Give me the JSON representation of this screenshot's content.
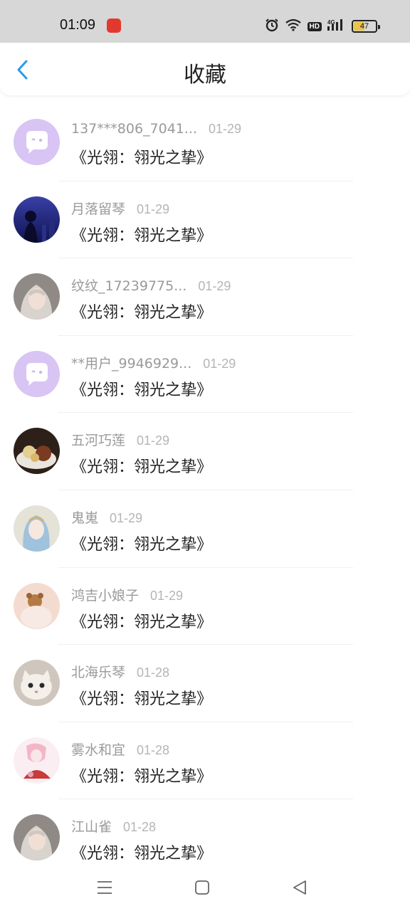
{
  "status_bar": {
    "time": "01:09",
    "battery": "47",
    "battery_level": 0.47,
    "hd_label": "HD",
    "net_label": "4G",
    "icons": [
      "app-notification-icon",
      "alarm-icon",
      "wifi-icon",
      "hd-icon",
      "4g-signal-icon",
      "battery-icon"
    ]
  },
  "header": {
    "title": "收藏",
    "back_icon": "chevron-left-icon",
    "accent_color": "#2a9ae8"
  },
  "items": [
    {
      "username": "137***806_7041...",
      "date": "01-29",
      "title": "《光翎：翎光之挚》",
      "avatar": "default-chat-avatar"
    },
    {
      "username": "月落留琴",
      "date": "01-29",
      "title": "《光翎：翎光之挚》",
      "avatar": "night-city-avatar"
    },
    {
      "username": "纹纹_17239775...",
      "date": "01-29",
      "title": "《光翎：翎光之挚》",
      "avatar": "portrait-avatar"
    },
    {
      "username": "**用户_9946929...",
      "date": "01-29",
      "title": "《光翎：翎光之挚》",
      "avatar": "default-chat-avatar"
    },
    {
      "username": "五河巧莲",
      "date": "01-29",
      "title": "《光翎：翎光之挚》",
      "avatar": "food-avatar"
    },
    {
      "username": "鬼嵬",
      "date": "01-29",
      "title": "《光翎：翎光之挚》",
      "avatar": "anime-avatar"
    },
    {
      "username": "鸿吉小娘子",
      "date": "01-29",
      "title": "《光翎：翎光之挚》",
      "avatar": "teddy-bear-avatar"
    },
    {
      "username": "北海乐琴",
      "date": "01-28",
      "title": "《光翎：翎光之挚》",
      "avatar": "cat-avatar"
    },
    {
      "username": "雾水和宜",
      "date": "01-28",
      "title": "《光翎：翎光之挚》",
      "avatar": "illustration-avatar"
    },
    {
      "username": "江山雀",
      "date": "01-28",
      "title": "《光翎：翎光之挚》",
      "avatar": "portrait-avatar"
    }
  ],
  "nav": {
    "icons": [
      "menu-icon",
      "home-square-icon",
      "back-triangle-icon"
    ]
  }
}
